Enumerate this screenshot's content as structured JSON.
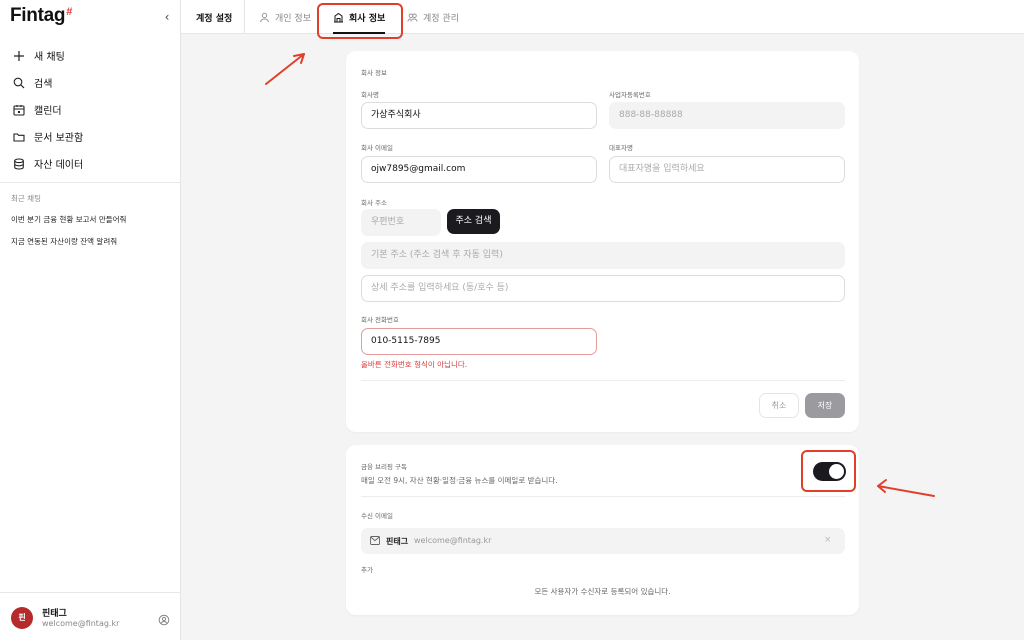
{
  "app": {
    "logo": "Fintag",
    "logo_mark": "#"
  },
  "sidebar": {
    "collapse_icon": "chevron-left-icon",
    "items": [
      {
        "label": "새 채팅",
        "icon": "plus-icon"
      },
      {
        "label": "검색",
        "icon": "search-icon"
      },
      {
        "label": "캘린더",
        "icon": "calendar-icon"
      },
      {
        "label": "문서 보관함",
        "icon": "folder-icon"
      },
      {
        "label": "자산 데이터",
        "icon": "database-icon"
      }
    ],
    "recent_heading": "최근 채팅",
    "recent": [
      "이번 분기 금융 현황 보고서 만들어줘",
      "지금 연동된 자산이랑 잔액 알려줘"
    ],
    "user": {
      "initial": "핀",
      "name": "핀태그",
      "email": "welcome@fintag.kr"
    }
  },
  "tabs": {
    "title": "계정 설정",
    "items": [
      {
        "label": "개인 정보",
        "icon": "user-icon",
        "active": false
      },
      {
        "label": "회사 정보",
        "icon": "building-icon",
        "active": true
      },
      {
        "label": "계정 관리",
        "icon": "users-icon",
        "active": false
      }
    ]
  },
  "company": {
    "section_title": "회사 정보",
    "name_label": "회사명",
    "name_value": "가상주식회사",
    "bizno_label": "사업자등록번호",
    "bizno_placeholder": "888-88-88888",
    "email_label": "회사 이메일",
    "email_value": "ojw7895@gmail.com",
    "ceo_label": "대표자명",
    "ceo_placeholder": "대표자명을 입력하세요",
    "address_label": "회사 주소",
    "postcode_placeholder": "우편번호",
    "address_search_button": "주소 검색",
    "address_placeholder": "기본 주소 (주소 검색 후 자동 입력)",
    "address_detail_placeholder": "상세 주소를 입력하세요 (동/호수 등)",
    "phone_label": "회사 전화번호",
    "phone_value": "010-5115-7895",
    "phone_error": "올바른 전화번호 형식이 아닙니다.",
    "cancel_button": "취소",
    "save_button": "저장"
  },
  "briefing": {
    "title": "금융 브리핑 구독",
    "description": "매일 오전 9시, 자산 현황·일정·금융 뉴스를 이메일로 받습니다.",
    "toggle_on": true,
    "recipient_label": "수신 이메일",
    "recipient": {
      "name": "핀태그",
      "email": "welcome@fintag.kr"
    },
    "add_label": "추가",
    "all_registered": "모든 사용자가 수신자로 등록되어 있습니다."
  },
  "colors": {
    "accent_dark": "#1a1a1f",
    "error": "#d93b3b",
    "annotation": "#e0402a",
    "avatar": "#b52a2a"
  }
}
